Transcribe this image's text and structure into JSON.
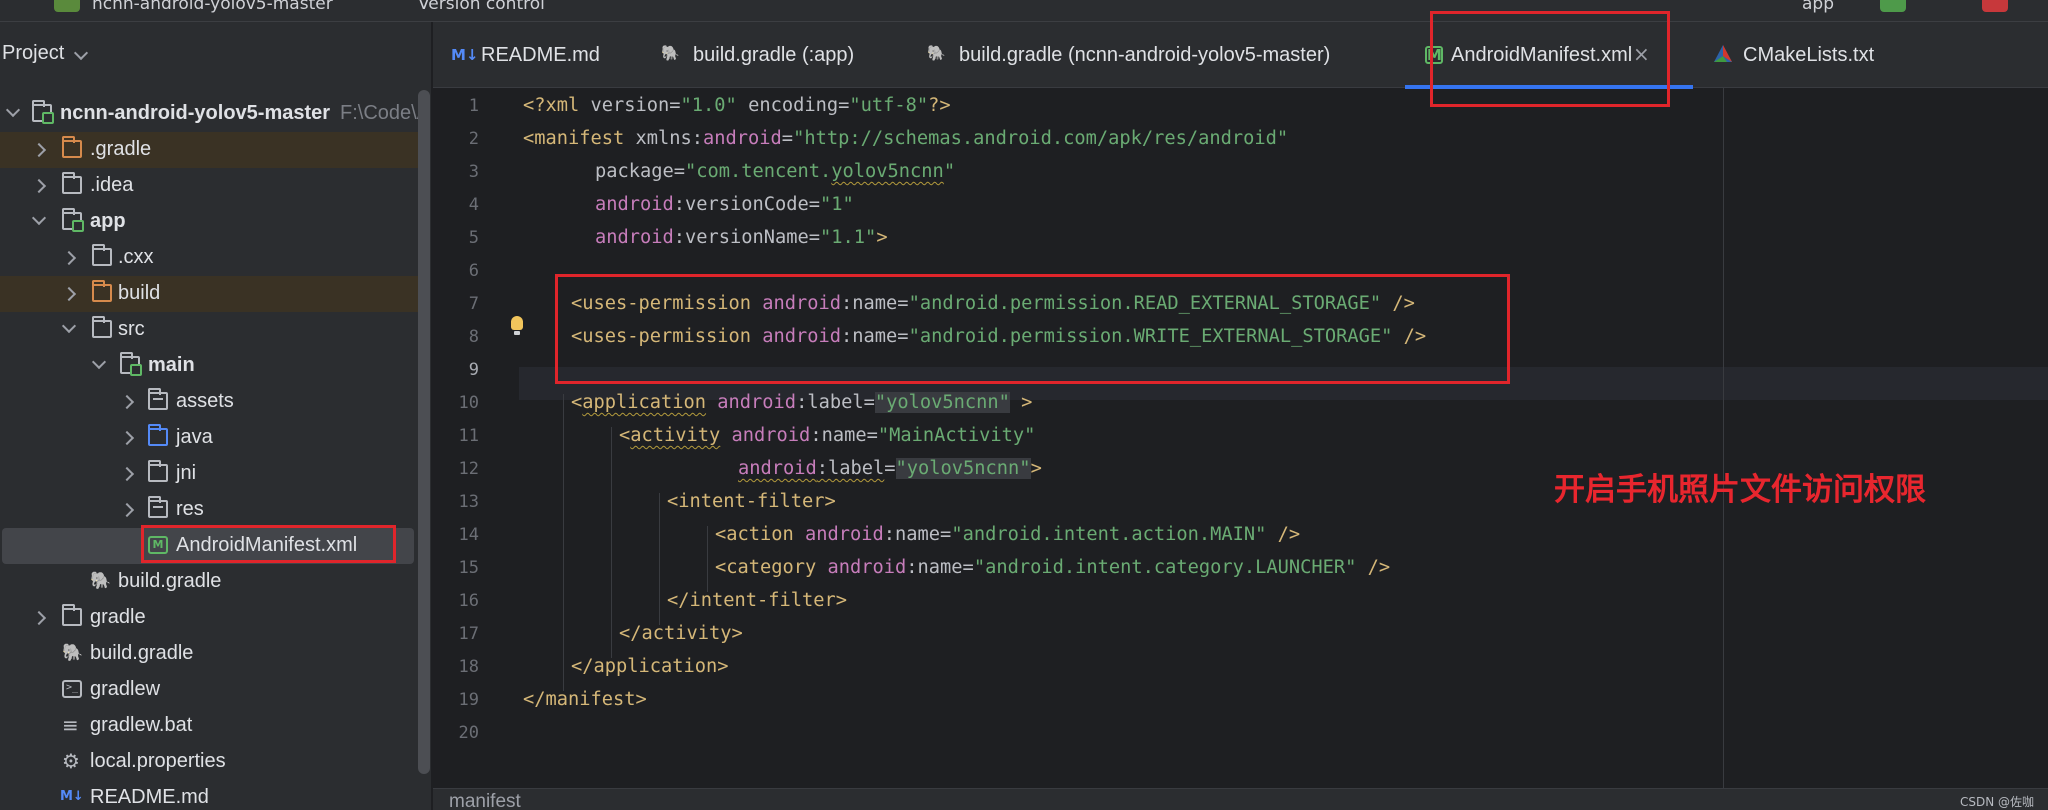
{
  "top_bar": {
    "project_name": "ncnn-android-yolov5-master",
    "version_control": "Version control",
    "run_config": "app"
  },
  "project_panel": {
    "title": "Project",
    "tree": [
      {
        "label": "ncnn-android-yolov5-master",
        "path": "F:\\Code\\A",
        "icon": "module-folder-icon",
        "arrow": "open"
      },
      {
        "label": ".gradle",
        "icon": "excluded-folder-icon",
        "arrow": "closed"
      },
      {
        "label": ".idea",
        "icon": "folder-icon",
        "arrow": "closed"
      },
      {
        "label": "app",
        "icon": "module-folder-icon",
        "arrow": "open"
      },
      {
        "label": ".cxx",
        "icon": "folder-icon",
        "arrow": "closed"
      },
      {
        "label": "build",
        "icon": "excluded-folder-icon",
        "arrow": "closed"
      },
      {
        "label": "src",
        "icon": "folder-icon",
        "arrow": "open"
      },
      {
        "label": "main",
        "icon": "source-folder-icon",
        "arrow": "open"
      },
      {
        "label": "assets",
        "icon": "resource-folder-icon",
        "arrow": "closed"
      },
      {
        "label": "java",
        "icon": "source-root-folder-icon",
        "arrow": "closed"
      },
      {
        "label": "jni",
        "icon": "folder-icon",
        "arrow": "closed"
      },
      {
        "label": "res",
        "icon": "resource-folder-icon",
        "arrow": "closed"
      },
      {
        "label": "AndroidManifest.xml",
        "icon": "xml-manifest-icon"
      },
      {
        "label": "build.gradle",
        "icon": "gradle-icon"
      },
      {
        "label": "gradle",
        "icon": "folder-icon",
        "arrow": "closed"
      },
      {
        "label": "build.gradle",
        "icon": "gradle-icon"
      },
      {
        "label": "gradlew",
        "icon": "terminal-file-icon"
      },
      {
        "label": "gradlew.bat",
        "icon": "text-file-icon"
      },
      {
        "label": "local.properties",
        "icon": "gear-icon"
      },
      {
        "label": "README.md",
        "icon": "markdown-icon"
      }
    ]
  },
  "tabs": [
    {
      "label": "README.md",
      "icon": "M↓"
    },
    {
      "label": "build.gradle (:app)",
      "icon": "gradle"
    },
    {
      "label": "build.gradle (ncnn-android-yolov5-master)",
      "icon": "gradle"
    },
    {
      "label": "AndroidManifest.xml",
      "icon": "M",
      "active": true
    },
    {
      "label": "CMakeLists.txt",
      "icon": "cmake"
    }
  ],
  "tab_close": "×",
  "line_numbers": [
    "1",
    "2",
    "3",
    "4",
    "5",
    "6",
    "7",
    "8",
    "9",
    "10",
    "11",
    "12",
    "13",
    "14",
    "15",
    "16",
    "17",
    "18",
    "19",
    "20"
  ],
  "code": {
    "l1": {
      "open": "<?xml ",
      "k1": "version",
      "eq1": "=",
      "v1": "\"1.0\"",
      "sp": " ",
      "k2": "encoding",
      "eq2": "=",
      "v2": "\"utf-8\"",
      "close": "?>"
    },
    "l2": {
      "open": "<manifest ",
      "ns": "xmlns:",
      "nsname": "android",
      "eq": "=",
      "val": "\"http://schemas.android.com/apk/res/android\""
    },
    "l3": {
      "attr": "package",
      "eq": "=",
      "val_a": "\"com.tencent.",
      "val_b": "yolov5ncnn",
      "val_c": "\""
    },
    "l4": {
      "ns": "android",
      "attr": ":versionCode",
      "eq": "=",
      "val": "\"1\""
    },
    "l5": {
      "ns": "android",
      "attr": ":versionName",
      "eq": "=",
      "val": "\"1.1\"",
      "close": ">"
    },
    "l7": {
      "open": "<uses-permission ",
      "ns": "android",
      "attr": ":name",
      "eq": "=",
      "val": "\"android.permission.READ_EXTERNAL_STORAGE\"",
      "close": " />"
    },
    "l8": {
      "open": "<uses-permission ",
      "ns": "android",
      "attr": ":name",
      "eq": "=",
      "val": "\"android.permission.WRITE_EXTERNAL_STORAGE\"",
      "close": " />"
    },
    "l10": {
      "lt": "<",
      "tag": "application",
      "sp": " ",
      "ns": "android",
      "attr": ":label",
      "eq": "=",
      "val": "\"yolov5ncnn\"",
      "close": " >"
    },
    "l11": {
      "lt": "<",
      "tag": "activity",
      "sp": " ",
      "ns": "android",
      "attr": ":name",
      "eq": "=",
      "val": "\"MainActivity\""
    },
    "l12": {
      "ns": "android",
      "attr": ":label",
      "eq": "=",
      "val": "\"yolov5ncnn\"",
      "close": ">"
    },
    "l13": {
      "tag": "<intent-filter>"
    },
    "l14": {
      "open": "<action ",
      "ns": "android",
      "attr": ":name",
      "eq": "=",
      "val": "\"android.intent.action.MAIN\"",
      "close": " />"
    },
    "l15": {
      "open": "<category ",
      "ns": "android",
      "attr": ":name",
      "eq": "=",
      "val": "\"android.intent.category.LAUNCHER\"",
      "close": " />"
    },
    "l16": {
      "tag": "</intent-filter>"
    },
    "l17": {
      "tag": "</activity>"
    },
    "l18": {
      "tag": "</application>"
    },
    "l19": {
      "tag": "</manifest>"
    }
  },
  "breadcrumb": "manifest",
  "annotation_text": "开启手机照片文件访问权限",
  "watermark": "CSDN @佐咖",
  "colors": {
    "annotation_red": "#e8262e",
    "highlight_box": "#e0252b",
    "active_tab_underline": "#3574f0",
    "xml_tag": "#d5b778",
    "xml_attr_ns": "#c77dbb",
    "xml_string": "#6aab73"
  }
}
